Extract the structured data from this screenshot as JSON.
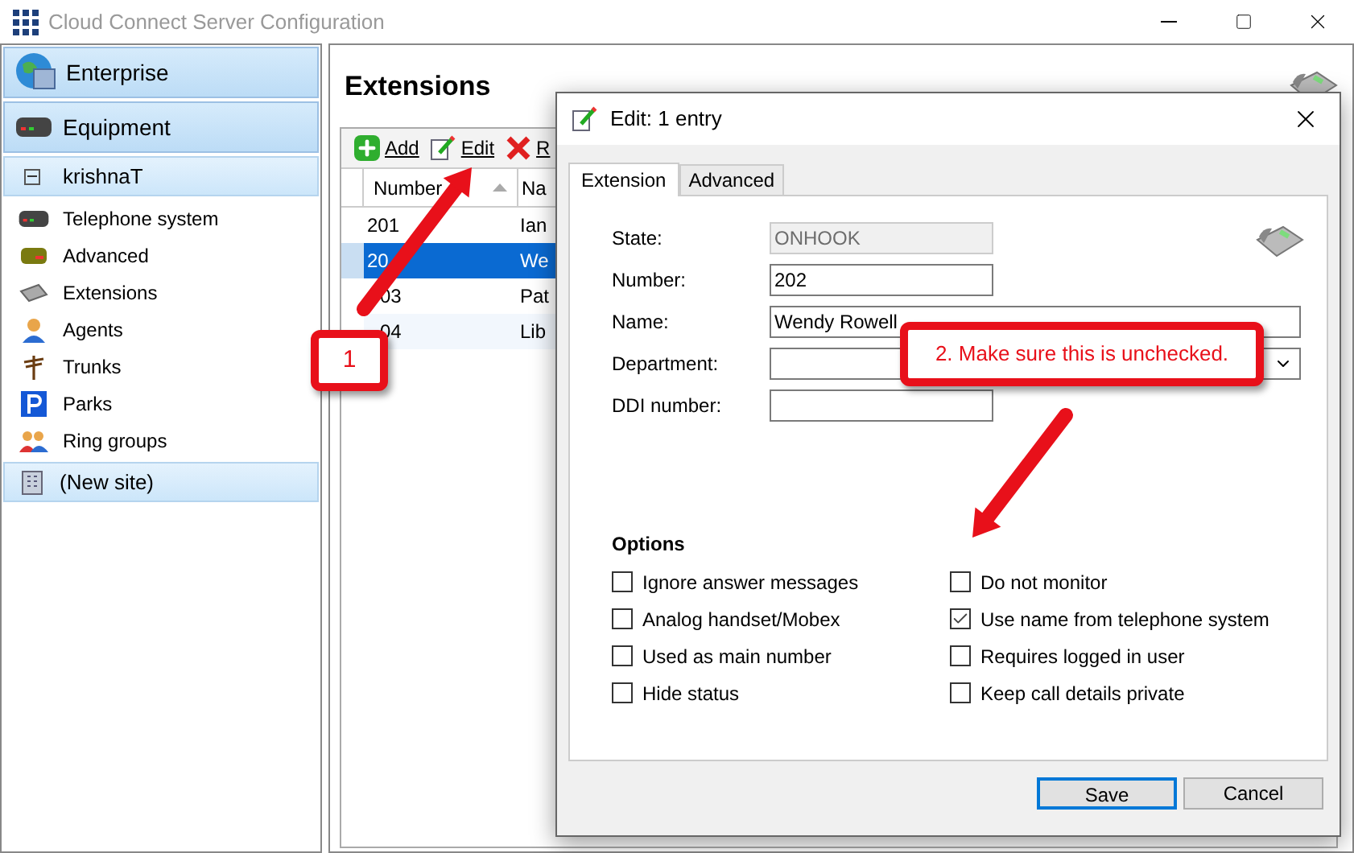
{
  "window": {
    "title": "Cloud Connect Server Configuration"
  },
  "sidebar": {
    "groups": [
      {
        "label": "Enterprise",
        "kind": "globe"
      },
      {
        "label": "Equipment",
        "kind": "device"
      }
    ],
    "site": {
      "label": "krishnaT",
      "expanded": true
    },
    "items": [
      {
        "label": "Telephone system",
        "kind": "device"
      },
      {
        "label": "Advanced",
        "kind": "device2"
      },
      {
        "label": "Extensions",
        "kind": "phone"
      },
      {
        "label": "Agents",
        "kind": "person"
      },
      {
        "label": "Trunks",
        "kind": "trunk"
      },
      {
        "label": "Parks",
        "kind": "parks"
      },
      {
        "label": "Ring groups",
        "kind": "people"
      }
    ],
    "new_site": {
      "label": "(New site)"
    }
  },
  "main": {
    "title": "Extensions",
    "toolbar": [
      {
        "label": "Add",
        "kind": "add"
      },
      {
        "label": "Edit",
        "kind": "edit"
      },
      {
        "label": "R",
        "kind": "remove"
      }
    ],
    "table": {
      "columns": [
        "Number",
        "Na"
      ],
      "rows": [
        {
          "cells": [
            "201",
            "Ian"
          ],
          "selected": false
        },
        {
          "cells": [
            "20",
            "We"
          ],
          "selected": true
        },
        {
          "cells": [
            "03",
            "Pat"
          ],
          "selected": false
        },
        {
          "cells": [
            "04",
            "Lib"
          ],
          "selected": false
        }
      ]
    }
  },
  "dialog": {
    "title": "Edit: 1 entry",
    "tabs": [
      {
        "label": "Extension",
        "selected": true
      },
      {
        "label": "Advanced",
        "selected": false
      }
    ],
    "fields": [
      {
        "label": "State:",
        "value": "ONHOOK",
        "disabled": true,
        "kind": "short"
      },
      {
        "label": "Number:",
        "value": "202",
        "disabled": false,
        "kind": "short"
      },
      {
        "label": "Name:",
        "value": "Wendy Rowell",
        "disabled": false,
        "kind": "wide"
      },
      {
        "label": "Department:",
        "disabled": false,
        "kind": "dropdown"
      },
      {
        "label": "DDI number:",
        "disabled": false,
        "kind": "short"
      }
    ],
    "options_title": "Options",
    "options": [
      {
        "label": "Ignore answer messages",
        "checked": false
      },
      {
        "label": "Do not monitor",
        "checked": false
      },
      {
        "label": "Analog handset/Mobex",
        "checked": false
      },
      {
        "label": "Use name from telephone system",
        "checked": true
      },
      {
        "label": "Used as main number",
        "checked": false
      },
      {
        "label": "Requires logged in user",
        "checked": false
      },
      {
        "label": "Hide status",
        "checked": false
      },
      {
        "label": "Keep call details private",
        "checked": false
      }
    ],
    "buttons": [
      {
        "label": "Save",
        "default": true
      },
      {
        "label": "Cancel",
        "default": false
      }
    ]
  },
  "annotations": [
    {
      "text": "1"
    },
    {
      "text": "2. Make sure this is unchecked."
    }
  ]
}
